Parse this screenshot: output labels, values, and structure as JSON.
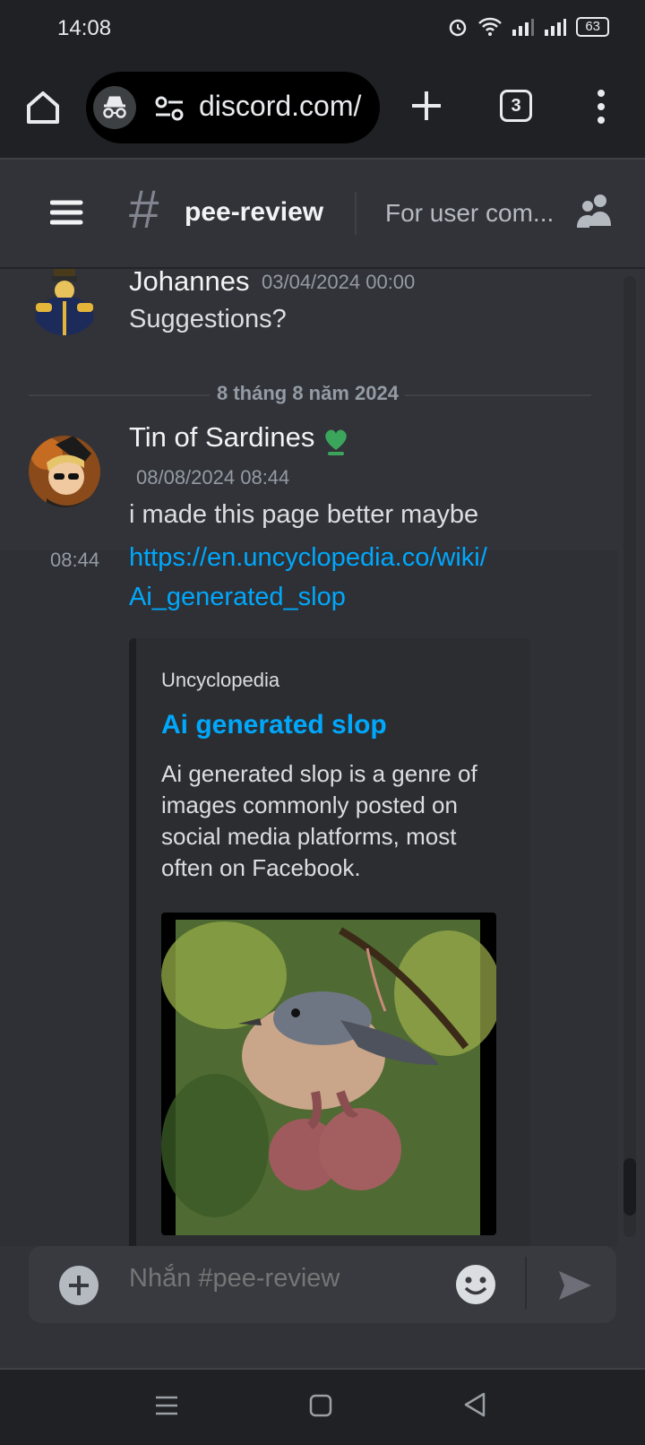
{
  "status_bar": {
    "time": "14:08",
    "battery": "63"
  },
  "browser": {
    "url": "discord.com/",
    "tab_count": "3"
  },
  "channel": {
    "name": "pee-review",
    "topic": "For user com..."
  },
  "messages": [
    {
      "author": "Johannes",
      "timestamp": "03/04/2024 00:00",
      "text": "Suggestions?"
    },
    {
      "author": "Tin of Sardines",
      "timestamp": "08/08/2024 08:44",
      "text": "i made this page better maybe"
    }
  ],
  "date_separator": "8 tháng 8 năm 2024",
  "followup": {
    "time": "08:44",
    "link_line1": "https://en.uncyclopedia.co/wiki/",
    "link_line2": "Ai_generated_slop"
  },
  "embed": {
    "provider": "Uncyclopedia",
    "title": "Ai generated slop",
    "description": "Ai generated slop is a genre of images commonly posted on social media platforms, most often on Facebook."
  },
  "composer": {
    "placeholder": "Nhắn #pee-review"
  },
  "colors": {
    "link": "#00a8fc",
    "background": "#313338",
    "badge": "#3ba55c"
  }
}
